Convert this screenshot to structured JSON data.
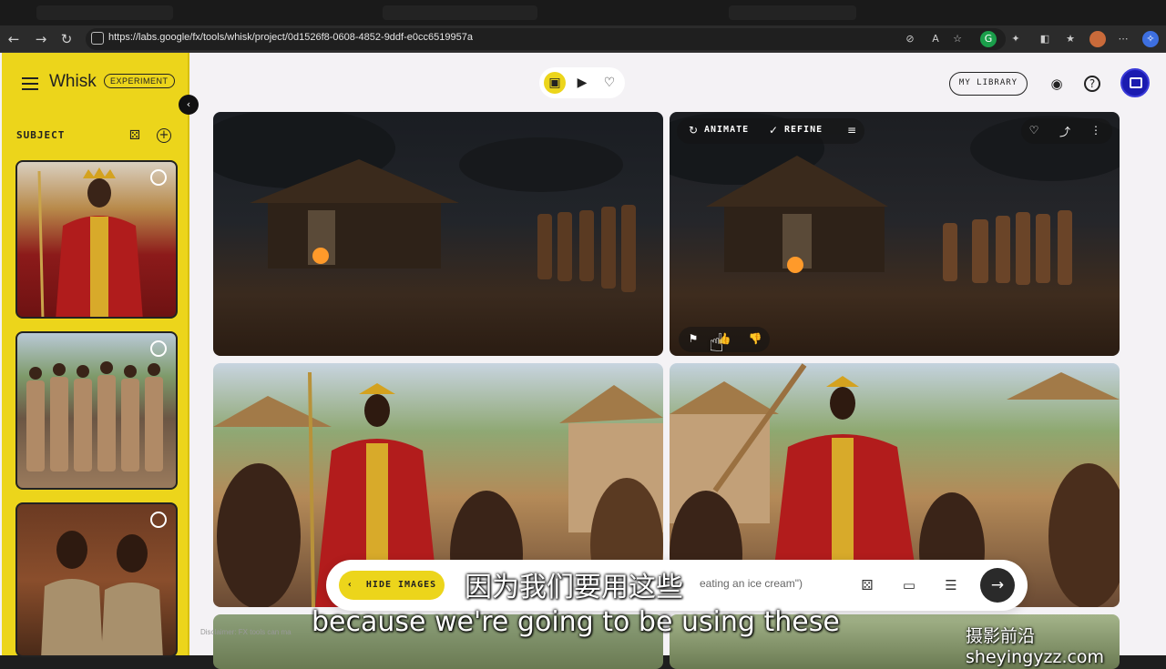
{
  "browser": {
    "url": "https://labs.google/fx/tools/whisk/project/0d1526f8-0608-4852-9ddf-e0cc6519957a"
  },
  "app": {
    "name": "Whisk",
    "badge": "EXPERIMENT",
    "my_library": "MY LIBRARY"
  },
  "sidebar": {
    "section_title": "SUBJECT"
  },
  "images": {
    "actions": {
      "animate": "ANIMATE",
      "refine": "REFINE"
    }
  },
  "prompt": {
    "hide_images": "HIDE IMAGES",
    "placeholder_fragment": "eating an ice cream\")"
  },
  "disclaimer": "Disclaimer: FX tools can ma",
  "subtitles": {
    "chinese": "因为我们要用这些",
    "english": "because we're going to be using these"
  },
  "watermark": "摄影前沿 sheyingyzz.com",
  "colors": {
    "sidebar": "#ecd51b",
    "accent_avatar": "#1b1bb0"
  }
}
